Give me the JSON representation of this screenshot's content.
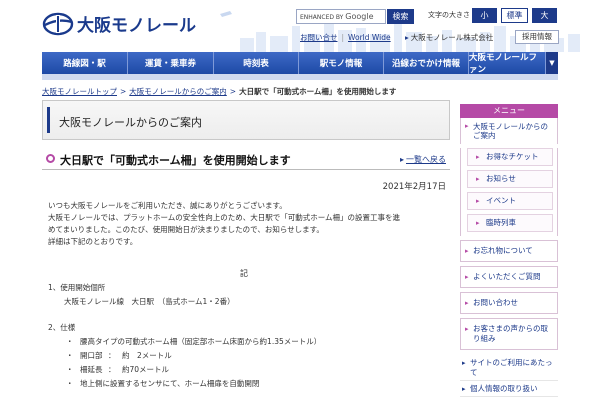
{
  "header": {
    "logo_text": "大阪モノレール",
    "search_placeholder_prefix": "ENHANCED BY",
    "search_placeholder_brand": "Google",
    "search_button": "検索",
    "font_size_label": "文字の大きさ",
    "font_small": "小",
    "font_standard": "標準",
    "font_large": "大",
    "contact_link": "お問い合せ",
    "world_wide_link": "World Wide",
    "company_link": "大阪モノレール株式会社",
    "recruit_button": "採用情報"
  },
  "nav": {
    "items": [
      {
        "label": "路線図・駅"
      },
      {
        "label": "運賃・乗車券"
      },
      {
        "label": "時刻表"
      },
      {
        "label": "駅モノ情報"
      },
      {
        "label": "沿線おでかけ情報"
      },
      {
        "label": "大阪モノレールファン"
      }
    ]
  },
  "breadcrumb": {
    "top": "大阪モノレールトップ",
    "section": "大阪モノレールからのご案内",
    "current": "大日駅で「可動式ホーム柵」を使用開始します",
    "separator": ">"
  },
  "main": {
    "section_title": "大阪モノレールからのご案内",
    "article_title": "大日駅で「可動式ホーム柵」を使用開始します",
    "back_link": "一覧へ戻る",
    "date": "2021年2月17日",
    "para1": "いつも大阪モノレールをご利用いただき、誠にありがとうございます。",
    "para2a": "大阪モノレールでは、プラットホームの安全性向上のため、大日駅で「可動式ホーム柵」の設置工事を進",
    "para2b": "めてまいりました。このたび、使用開始日が決まりましたので、お知らせします。",
    "para3": "詳細は下記のとおりです。",
    "ki": "記",
    "item1_title": "1、使用開始個所",
    "item1_detail": "大阪モノレール線　大日駅　（島式ホーム1・2番）",
    "item2_title": "2、仕様",
    "spec1_bullet": "・",
    "spec1": "腰高タイプの可動式ホーム柵（固定部ホーム床面から約1.35メートル）",
    "spec2_bullet": "・",
    "spec2_label": "開口部",
    "spec2_sep": "：",
    "spec2_value": "約　2メートル",
    "spec3_bullet": "・",
    "spec3_label": "柵延長",
    "spec3_sep": "：",
    "spec3_value": "約70メートル",
    "spec4_bullet": "・",
    "spec4": "地上側に設置するセンサにて、ホーム柵扉を自動開閉"
  },
  "sidebar": {
    "menu_header": "メニュー",
    "main_item": "大阪モノレールからのご案内",
    "sub_items": [
      {
        "label": "お得なチケット"
      },
      {
        "label": "お知らせ"
      },
      {
        "label": "イベント"
      },
      {
        "label": "臨時列車"
      }
    ],
    "blocks": [
      {
        "label": "お忘れ物について"
      },
      {
        "label": "よくいただくご質問"
      },
      {
        "label": "お問い合わせ"
      },
      {
        "label": "お客さまの声からの取り組み"
      }
    ],
    "links": [
      {
        "label": "サイトのご利用にあたって"
      },
      {
        "label": "個人情報の取り扱い"
      }
    ]
  }
}
